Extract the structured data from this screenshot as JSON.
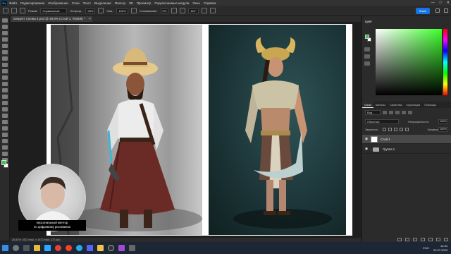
{
  "menu": {
    "app_icon": "Ps",
    "items": [
      "Файл",
      "Редактирование",
      "Изображение",
      "Слои",
      "Текст",
      "Выделение",
      "Фильтр",
      "3D",
      "Просмотр",
      "Подключаемые модули",
      "Окно",
      "Справка"
    ]
  },
  "window_controls": [
    "—",
    "□",
    "✕"
  ],
  "options": {
    "brush_size": "",
    "mode_label": "Режим:",
    "mode_value": "Нормальный",
    "opacity_label": "Непрозр.:",
    "opacity_value": "98%",
    "flow_label": "Наж.:",
    "flow_value": "100%",
    "smoothing_label": "Сглаживание:",
    "smoothing_value": "0%",
    "angle_value": "161°",
    "share_label": "Share"
  },
  "document": {
    "tab_title": "концепт голова 4.psd @ 26,8% (Слой 1, RGB/8) *",
    "close_glyph": "×"
  },
  "status": {
    "text": "26,82%    1432 пикс. x 1873 пикс. (72 ppi)"
  },
  "colors": {
    "foreground": "#39c44d",
    "background": "#ffffff",
    "accent": "#1473e6"
  },
  "color_panel": {
    "title": "Цвет"
  },
  "layers_panel": {
    "tabs": [
      "Слои",
      "Каналы",
      "Свойства",
      "Коррекция",
      "Образцы"
    ],
    "filter_label": "Вид",
    "blend_mode": "Обычные",
    "opacity_label": "Непрозрачность:",
    "opacity_value": "100%",
    "lock_label": "Закрепить:",
    "fill_label": "Заливка:",
    "fill_value": "100%",
    "layers": [
      {
        "name": "Слой 1",
        "visible": true,
        "selected": true,
        "type": "layer"
      },
      {
        "name": "Группа 1",
        "visible": true,
        "selected": false,
        "type": "group"
      }
    ]
  },
  "webcam": {
    "caption_line1": "персональный ментор",
    "caption_line2": "по цифровому рисованию"
  },
  "taskbar": {
    "icons": [
      "windows-icon",
      "search-icon",
      "taskview-icon",
      "explorer-icon",
      "photoshop-icon",
      "chrome-icon",
      "yandex-icon",
      "telegram-icon",
      "discord-icon",
      "folder-icon",
      "obs-icon",
      "media-icon",
      "settings-icon"
    ],
    "language": "ENG",
    "time": "14:34",
    "date": "22.07.2023"
  }
}
